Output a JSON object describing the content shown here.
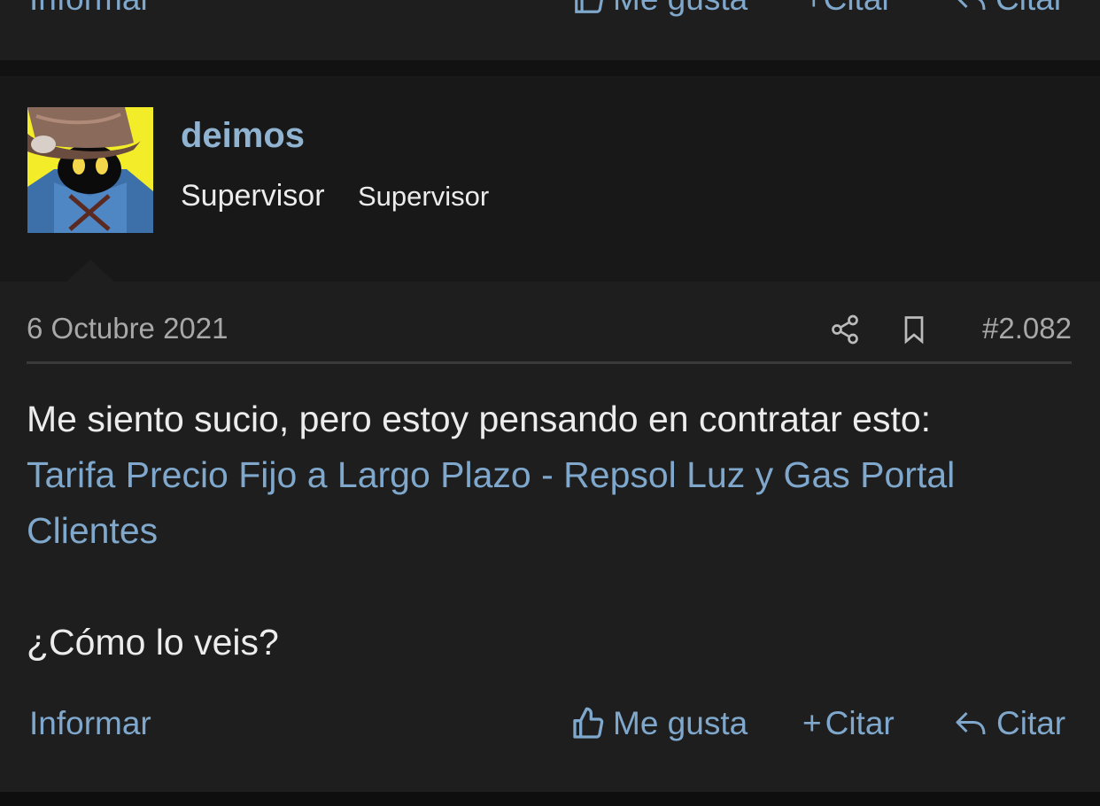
{
  "previous_post": {
    "report_label": "Informar",
    "like_label": "Me gusta",
    "plus_quote_label": "Citar",
    "reply_label": "Citar"
  },
  "post": {
    "author": {
      "username": "deimos",
      "role_primary": "Supervisor",
      "role_secondary": "Supervisor",
      "avatar_icon": "black-mage-avatar"
    },
    "date": "6 Octubre 2021",
    "number": "#2.082",
    "icons": {
      "share": "share-icon",
      "bookmark": "bookmark-icon"
    },
    "text_intro": "Me siento sucio, pero estoy pensando en contratar esto:",
    "link_text": "Tarifa Precio Fijo a Largo Plazo - Repsol Luz y Gas Portal Clientes",
    "text_question": "¿Cómo lo veis?",
    "actions": {
      "report_label": "Informar",
      "like_label": "Me gusta",
      "plus_quote_label": "Citar",
      "reply_label": "Citar"
    }
  },
  "colors": {
    "link": "#7fa8cc",
    "username": "#8fb3d0",
    "background": "#1e1e1e"
  }
}
